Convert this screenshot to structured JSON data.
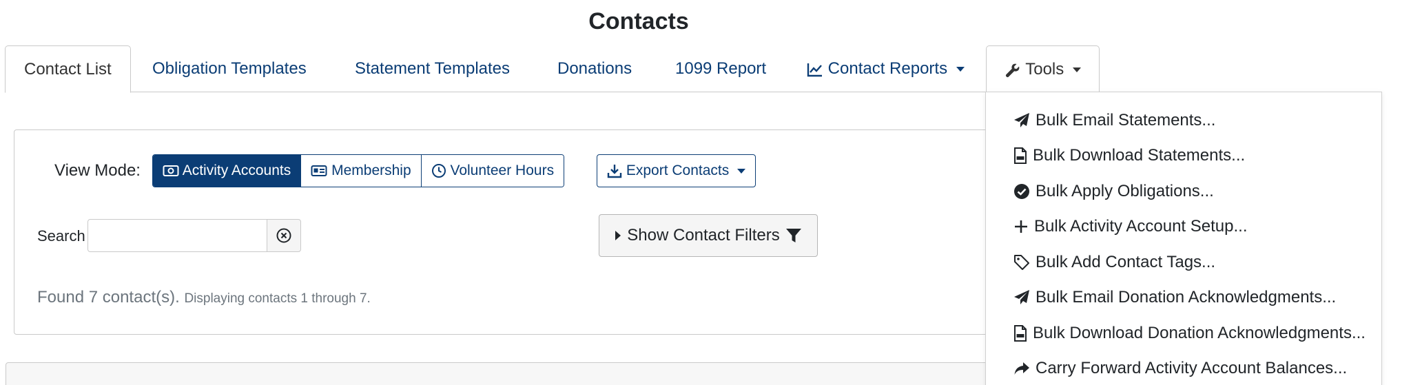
{
  "page": {
    "title": "Contacts"
  },
  "tabs": [
    {
      "label": "Contact List",
      "active": true
    },
    {
      "label": "Obligation Templates"
    },
    {
      "label": "Statement Templates"
    },
    {
      "label": "Donations"
    },
    {
      "label": "1099 Report"
    },
    {
      "label": "Contact Reports",
      "icon": "line-chart-icon",
      "dropdown": true
    },
    {
      "label": "Tools",
      "icon": "wrench-icon",
      "dropdown": true,
      "open": true
    }
  ],
  "view_mode": {
    "label": "View Mode:",
    "options": [
      {
        "label": "Activity Accounts",
        "icon": "money-icon",
        "selected": true
      },
      {
        "label": "Membership",
        "icon": "id-card-icon"
      },
      {
        "label": "Volunteer Hours",
        "icon": "clock-icon"
      }
    ]
  },
  "export": {
    "label": "Export Contacts",
    "icon": "download-icon"
  },
  "search": {
    "label": "Search",
    "value": "",
    "placeholder": ""
  },
  "filters": {
    "label": "Show Contact Filters",
    "icon": "filter-icon"
  },
  "results": {
    "found": "Found 7 contact(s).",
    "displaying": "Displaying contacts 1 through 7."
  },
  "tools_menu": [
    {
      "label": "Bulk Email Statements...",
      "icon": "paper-plane-icon"
    },
    {
      "label": "Bulk Download Statements...",
      "icon": "pdf-file-icon"
    },
    {
      "label": "Bulk Apply Obligations...",
      "icon": "check-circle-icon"
    },
    {
      "label": "Bulk Activity Account Setup...",
      "icon": "plus-icon"
    },
    {
      "label": "Bulk Add Contact Tags...",
      "icon": "tag-icon"
    },
    {
      "label": "Bulk Email Donation Acknowledgments...",
      "icon": "paper-plane-icon"
    },
    {
      "label": "Bulk Download Donation Acknowledgments...",
      "icon": "pdf-file-icon"
    },
    {
      "label": "Carry Forward Activity Account Balances...",
      "icon": "share-arrow-icon"
    }
  ],
  "colors": {
    "primary": "#0b3d75",
    "text": "#212529",
    "muted": "#6c757d",
    "border": "#c9c9c9"
  }
}
